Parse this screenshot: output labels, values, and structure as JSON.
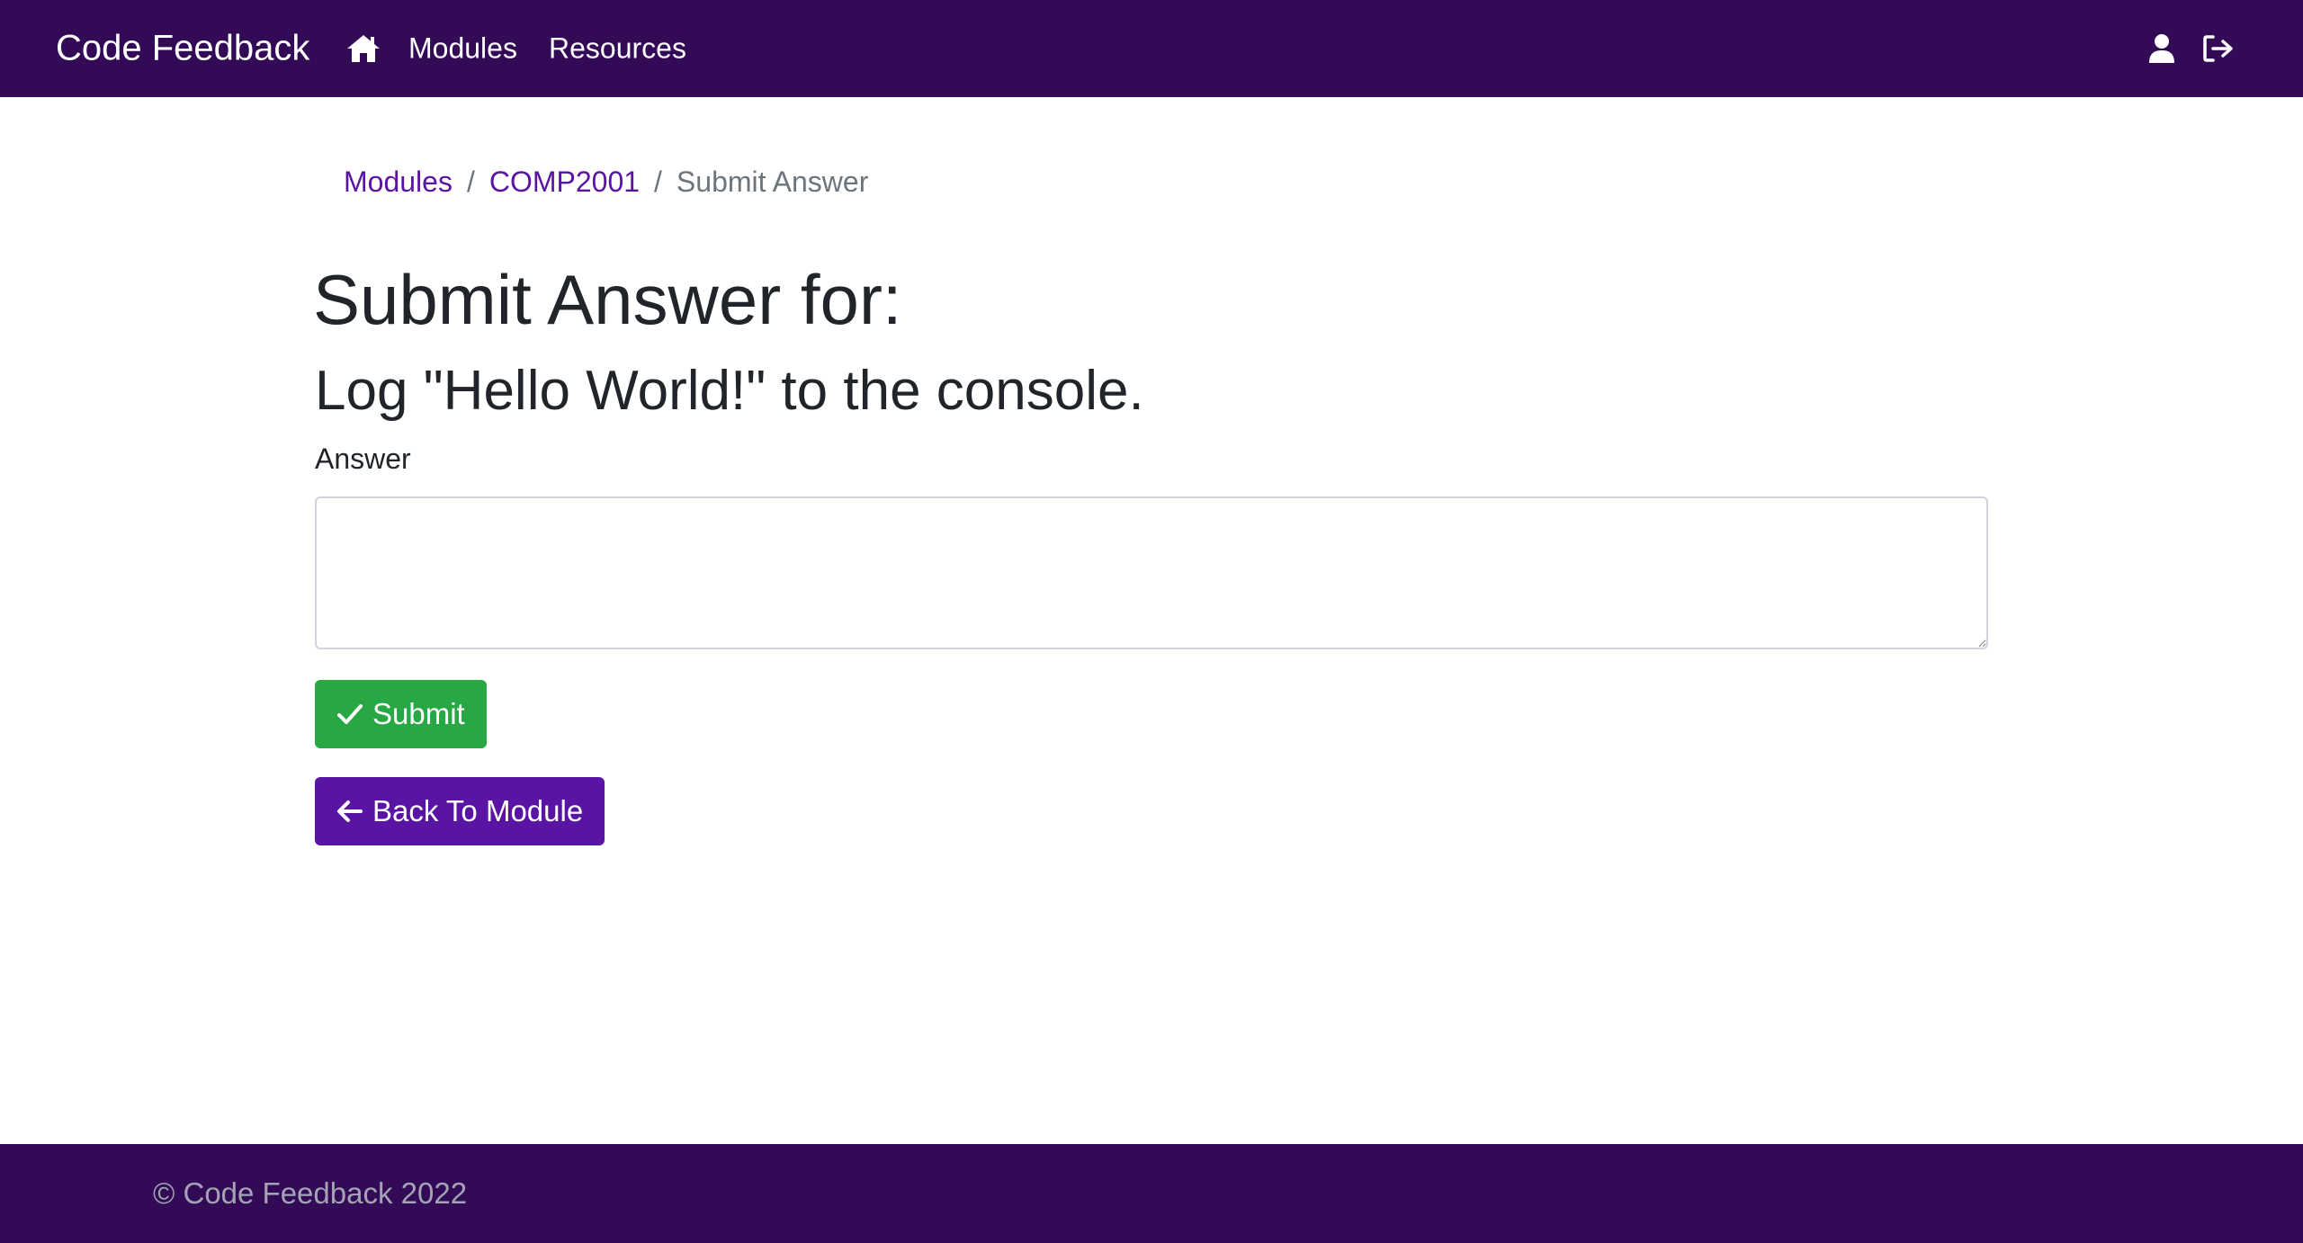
{
  "navbar": {
    "brand": "Code Feedback",
    "home_icon": "home-icon",
    "links": [
      "Modules",
      "Resources"
    ],
    "user_icon": "user-icon",
    "logout_icon": "logout-icon"
  },
  "breadcrumb": {
    "items": [
      "Modules",
      "COMP2001"
    ],
    "separator": "/",
    "current": "Submit Answer"
  },
  "main": {
    "title": "Submit Answer for:",
    "question": "Log \"Hello World!\" to the console.",
    "answer_label": "Answer",
    "answer_value": "",
    "submit_label": "Submit",
    "submit_icon": "check-icon",
    "back_label": "Back To Module",
    "back_icon": "arrow-left-icon"
  },
  "footer": {
    "text": "© Code Feedback 2022"
  },
  "colors": {
    "navbar_bg": "#320a56",
    "link": "#5a14a3",
    "submit": "#28a745",
    "back": "#5a14a3"
  }
}
